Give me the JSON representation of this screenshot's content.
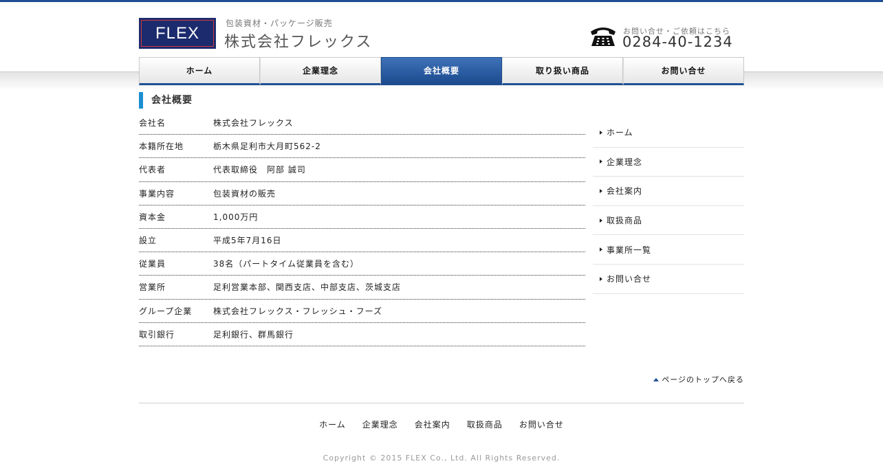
{
  "header": {
    "logo_text": "FLEX",
    "tagline": "包装資材・パッケージ販売",
    "company_name": "株式会社フレックス",
    "contact_label": "お問い合せ・ご依頼はこちら",
    "phone": "0284-40-1234"
  },
  "nav": {
    "items": [
      {
        "label": "ホーム"
      },
      {
        "label": "企業理念"
      },
      {
        "label": "会社概要"
      },
      {
        "label": "取り扱い商品"
      },
      {
        "label": "お問い合せ"
      }
    ],
    "active": "会社概要"
  },
  "main": {
    "heading": "会社概要",
    "rows": [
      {
        "label": "会社名",
        "value": "株式会社フレックス"
      },
      {
        "label": "本籍所在地",
        "value": "栃木県足利市大月町562-2"
      },
      {
        "label": "代表者",
        "value": "代表取締役　阿部 誠司"
      },
      {
        "label": "事業内容",
        "value": "包装資材の販売"
      },
      {
        "label": "資本金",
        "value": "1,000万円"
      },
      {
        "label": "設立",
        "value": "平成5年7月16日"
      },
      {
        "label": "従業員",
        "value": "38名（パートタイム従業員を含む）"
      },
      {
        "label": "営業所",
        "value": "足利営業本部、関西支店、中部支店、茨城支店"
      },
      {
        "label": "グループ企業",
        "value": "株式会社フレックス・フレッシュ・フーズ"
      },
      {
        "label": "取引銀行",
        "value": "足利銀行、群馬銀行"
      }
    ]
  },
  "sidebar": {
    "items": [
      {
        "label": "ホーム"
      },
      {
        "label": "企業理念"
      },
      {
        "label": "会社案内"
      },
      {
        "label": "取扱商品"
      },
      {
        "label": "事業所一覧"
      },
      {
        "label": "お問い合せ"
      }
    ]
  },
  "back_to_top": "ページのトップへ戻る",
  "footer": {
    "links": [
      {
        "label": "ホーム"
      },
      {
        "label": "企業理念"
      },
      {
        "label": "会社案内"
      },
      {
        "label": "取扱商品"
      },
      {
        "label": "お問い合せ"
      }
    ],
    "copyright": "Copyright © 2015 FLEX Co., Ltd. All Rights Reserved."
  },
  "colors": {
    "accent": "#1e4f94",
    "heading_bar": "#1b8ed1"
  }
}
